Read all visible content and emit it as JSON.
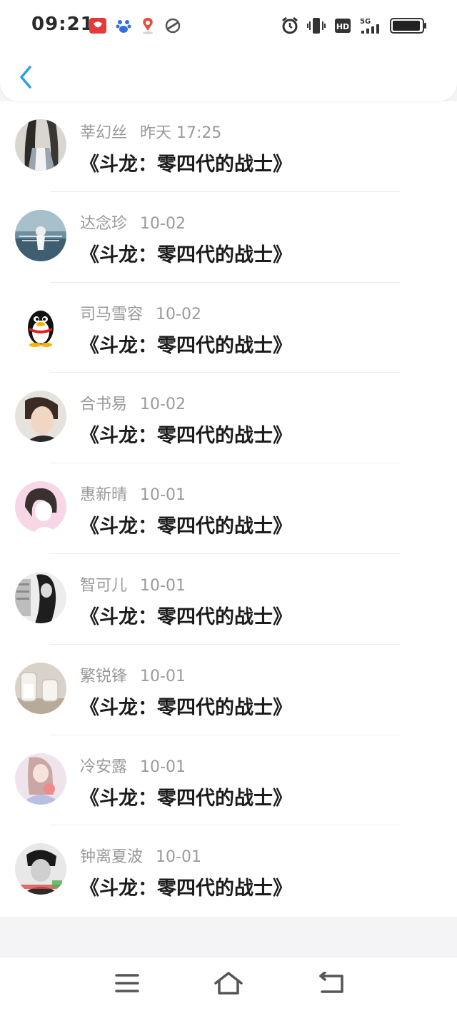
{
  "status_bar": {
    "time": "09:21",
    "network": "5G"
  },
  "colors": {
    "accent": "#2aa0e6",
    "name_text": "#9a9a9a",
    "title_text": "#1c1c1c"
  },
  "header": {
    "back_icon": "chevron-left-icon"
  },
  "comments": [
    {
      "name": "莘幻丝",
      "date": "昨天 17:25",
      "title": "《斗龙：零四代的战士》",
      "avatar": "girl-photo"
    },
    {
      "name": "达念珍",
      "date": "10-02",
      "title": "《斗龙：零四代的战士》",
      "avatar": "sea-photo"
    },
    {
      "name": "司马雪容",
      "date": "10-02",
      "title": "《斗龙：零四代的战士》",
      "avatar": "qq-penguin"
    },
    {
      "name": "合书易",
      "date": "10-02",
      "title": "《斗龙：零四代的战士》",
      "avatar": "boy-photo"
    },
    {
      "name": "惠新晴",
      "date": "10-01",
      "title": "《斗龙：零四代的战士》",
      "avatar": "anime-girl"
    },
    {
      "name": "智可儿",
      "date": "10-01",
      "title": "《斗龙：零四代的战士》",
      "avatar": "bw-photo"
    },
    {
      "name": "繁锐锋",
      "date": "10-01",
      "title": "《斗龙：零四代的战士》",
      "avatar": "bottles-photo"
    },
    {
      "name": "冷安露",
      "date": "10-01",
      "title": "《斗龙：零四代的战士》",
      "avatar": "pink-girl"
    },
    {
      "name": "钟离夏波",
      "date": "10-01",
      "title": "《斗龙：零四代的战士》",
      "avatar": "bw-boy"
    }
  ],
  "nav_bar": {
    "menu_icon": "menu-icon",
    "home_icon": "home-icon",
    "back_icon": "return-icon"
  }
}
